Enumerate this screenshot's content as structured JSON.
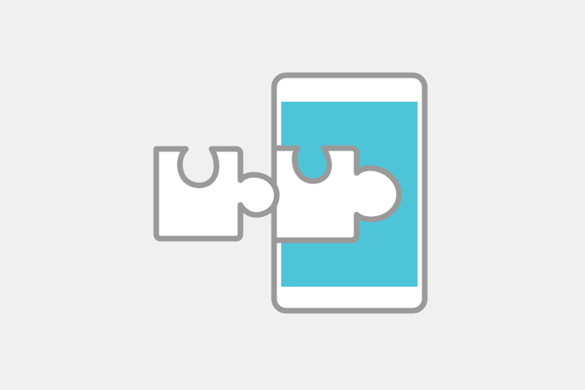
{
  "colors": {
    "background": "#f0f0f0",
    "outline": "#9a9a9a",
    "screen": "#4ec4d8",
    "phone_body": "#ffffff",
    "puzzle_fill": "#ffffff"
  },
  "icons": {
    "logo": "xposed-framework-logo",
    "phone": "smartphone-icon",
    "screen": "phone-screen",
    "docked_piece": "puzzle-piece-icon",
    "loose_piece": "puzzle-piece-icon"
  }
}
